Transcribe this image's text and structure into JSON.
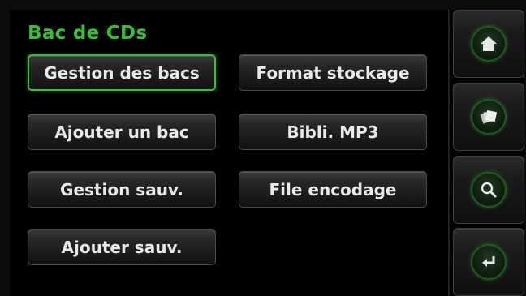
{
  "title": "Bac de CDs",
  "buttons": [
    {
      "label": "Gestion des bacs",
      "selected": true
    },
    {
      "label": "Ajouter un bac",
      "selected": false
    },
    {
      "label": "Gestion sauv.",
      "selected": false
    },
    {
      "label": "Ajouter sauv.",
      "selected": false
    },
    {
      "label": "Format stockage",
      "selected": false
    },
    {
      "label": "Bibli. MP3",
      "selected": false
    },
    {
      "label": "File encodage",
      "selected": false
    }
  ],
  "side_buttons": [
    {
      "icon": "home-icon"
    },
    {
      "icon": "cds-icon"
    },
    {
      "icon": "search-icon"
    },
    {
      "icon": "return-icon"
    }
  ],
  "colors": {
    "accent": "#37c032",
    "background": "#000000",
    "text": "#e9e9e9"
  }
}
